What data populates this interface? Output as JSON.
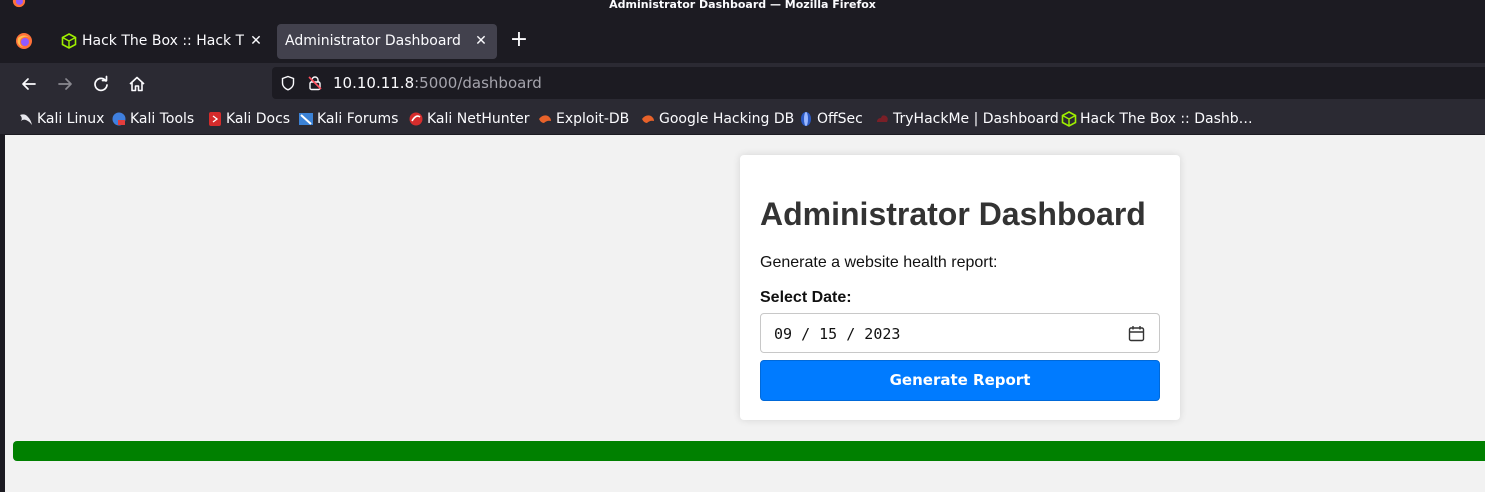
{
  "window": {
    "title": "Administrator Dashboard — Mozilla Firefox",
    "browser_icon": "firefox-icon"
  },
  "tabs": [
    {
      "label": "Hack The Box :: Hack The Box",
      "icon": "htb-cube-icon",
      "active": false
    },
    {
      "label": "Administrator Dashboard",
      "active": true
    }
  ],
  "nav": {
    "url_host": "10.10.11.8",
    "url_rest": ":5000/dashboard"
  },
  "bookmarks": [
    {
      "label": "Kali Linux",
      "icon": "kali-dragon-icon"
    },
    {
      "label": "Kali Tools",
      "icon": "kali-tools-icon"
    },
    {
      "label": "Kali Docs",
      "icon": "kali-docs-icon"
    },
    {
      "label": "Kali Forums",
      "icon": "kali-forums-icon"
    },
    {
      "label": "Kali NetHunter",
      "icon": "kali-nethunter-icon"
    },
    {
      "label": "Exploit-DB",
      "icon": "exploit-db-icon"
    },
    {
      "label": "Google Hacking DB",
      "icon": "ghdb-icon"
    },
    {
      "label": "OffSec",
      "icon": "offsec-icon"
    },
    {
      "label": "TryHackMe | Dashboard",
      "icon": "tryhackme-icon"
    },
    {
      "label": "Hack The Box :: Dashb…",
      "icon": "htb-cube-icon"
    }
  ],
  "page": {
    "heading": "Administrator Dashboard",
    "description": "Generate a website health report:",
    "date_label": "Select Date:",
    "date_value": "09 / 15 / 2023",
    "button_label": "Generate Report",
    "progress_fraction": 1.0
  },
  "colors": {
    "accent_button": "#007bff",
    "progress_fill": "#008000",
    "toolbar": "#2b2a33",
    "tabstrip": "#1c1b22"
  }
}
